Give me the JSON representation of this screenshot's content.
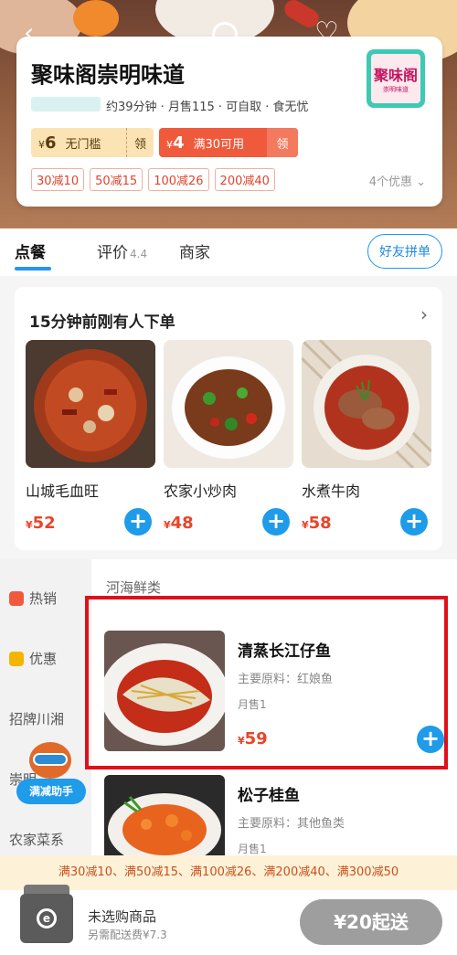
{
  "header": {
    "back_icon": "back-arrow-icon",
    "search_icon": "search-icon",
    "favorite_icon": "heart-icon"
  },
  "shop": {
    "name": "聚味阁崇明味道",
    "meta": "约39分钟 · 月售115 · 可自取 · 食无忧",
    "logo_text": "聚味阁",
    "logo_subtext": "崇明味道",
    "coupons": [
      {
        "currency": "¥",
        "amount": "6",
        "desc": "无门槛",
        "action": "领"
      },
      {
        "currency": "¥",
        "amount": "4",
        "desc": "满30可用",
        "action": "领"
      }
    ],
    "promo_tags": [
      "30减10",
      "50减15",
      "100减26",
      "200减40"
    ],
    "promo_more": "4个优惠 ⌄"
  },
  "tabs": {
    "order": "点餐",
    "reviews": "评价",
    "rating": "4.4",
    "merchant": "商家",
    "friends_button": "好友拼单"
  },
  "recent": {
    "title": "15分钟前刚有人下单",
    "arrow": "›",
    "dishes": [
      {
        "name": "山城毛血旺",
        "currency": "¥",
        "price": "52"
      },
      {
        "name": "农家小炒肉",
        "currency": "¥",
        "price": "48"
      },
      {
        "name": "水煮牛肉",
        "currency": "¥",
        "price": "58"
      }
    ]
  },
  "sidebar": {
    "items": [
      {
        "label": "热销",
        "icon": "fire-icon",
        "color": "#f05a3c"
      },
      {
        "label": "优惠",
        "icon": "discount-icon",
        "color": "#f5b400"
      },
      {
        "label": "招牌川湘"
      },
      {
        "label": "崇明"
      },
      {
        "label": "农家菜系"
      }
    ]
  },
  "menu": {
    "section_title": "河海鲜类",
    "items": [
      {
        "title": "清蒸长江仔鱼",
        "ingredients": "主要原料：红娘鱼",
        "sold": "月售1",
        "currency": "¥",
        "price": "59"
      },
      {
        "title": "松子桂鱼",
        "ingredients": "主要原料：其他鱼类",
        "sold": "月售1"
      }
    ]
  },
  "helper": {
    "label": "满减助手"
  },
  "promo_bar": "满30减10、满50减15、满100减26、满200减40、满300减50",
  "cart": {
    "title": "未选购商品",
    "delivery": "另需配送费¥7.3",
    "checkout": "¥20起送"
  },
  "colors": {
    "accent": "#1e9be9",
    "price": "#e8442a",
    "highlight_box": "#e0101a"
  }
}
